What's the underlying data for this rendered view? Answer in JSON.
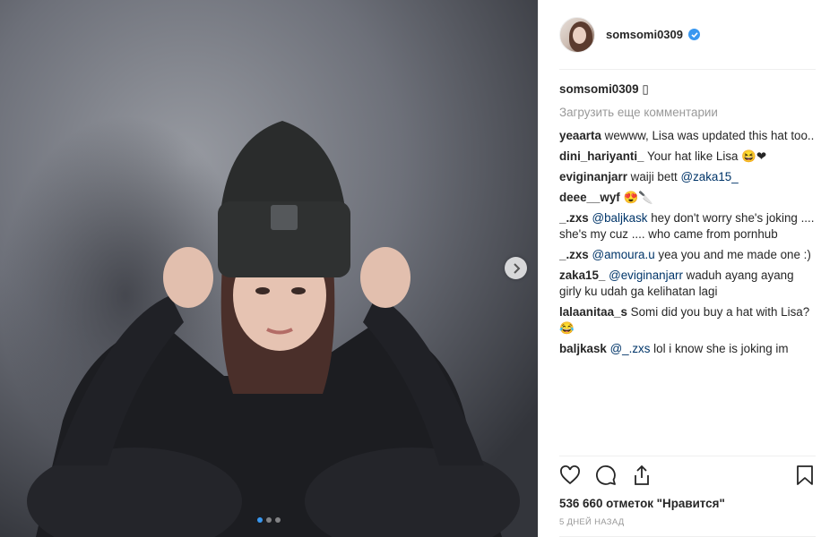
{
  "post": {
    "author": "somsomi0309",
    "caption_emoji": "▯",
    "load_more": "Загрузить еще комментарии",
    "carousel": {
      "count": 3,
      "active": 0
    },
    "comments": [
      {
        "user": "yeaarta",
        "text": "wewww, Lisa was updated this hat too.."
      },
      {
        "user": "dini_hariyanti_",
        "text": "Your hat like Lisa 😆❤"
      },
      {
        "user": "eviginanjarr",
        "text": "waiji bett ",
        "mention": "@zaka15_",
        "tail": ""
      },
      {
        "user": "deee__wyf",
        "text": "😍🔪"
      },
      {
        "user": "_.zxs",
        "text": "",
        "mention": "@baljkask",
        "tail": " hey don't worry she's joking .... she's my cuz .... who came from pornhub"
      },
      {
        "user": "_.zxs",
        "text": "",
        "mention": "@amoura.u",
        "tail": " yea you and me made one :)"
      },
      {
        "user": "zaka15_",
        "text": "",
        "mention": "@eviginanjarr",
        "tail": " waduh ayang ayang girly ku udah ga kelihatan lagi"
      },
      {
        "user": "lalaanitaa_s",
        "text": "Somi did you buy a hat with Lisa? 😂"
      },
      {
        "user": "baljkask",
        "text": "",
        "mention": "@_.zxs",
        "tail": " lol i know she is joking im"
      }
    ],
    "likes": "536 660 отметок \"Нравится\"",
    "time": "5 дней назад"
  },
  "colors": {
    "accent": "#3897f0",
    "text": "#262626",
    "muted": "#999999",
    "mention": "#003569"
  },
  "icons": [
    "chevron-right-icon",
    "verified-icon",
    "heart-icon",
    "comment-icon",
    "share-icon",
    "bookmark-icon"
  ]
}
